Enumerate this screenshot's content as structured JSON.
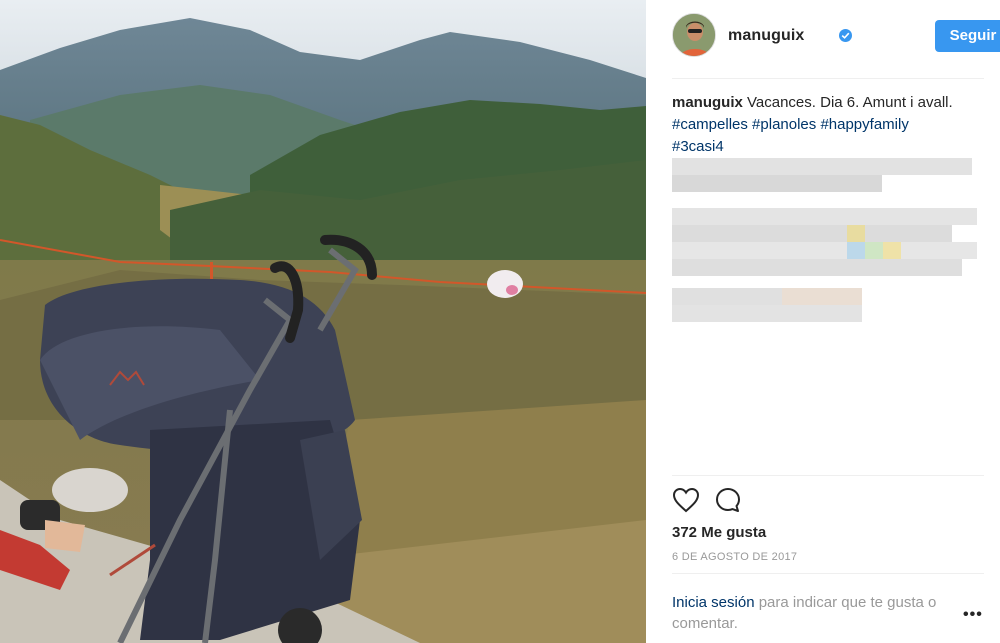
{
  "post": {
    "username": "manuguix",
    "follow_label": "Seguir",
    "caption_user": "manuguix",
    "caption_text": "Vacances. Dia 6. Amunt i avall.",
    "hashtags": [
      "#campelles",
      "#planoles",
      "#happyfamily",
      "#3casi4"
    ],
    "likes": "372 Me gusta",
    "date": "6 DE AGOSTO DE 2017",
    "login_link": "Inicia sesión",
    "login_rest": "para indicar que te gusta o comentar.",
    "more": "•••"
  },
  "colors": {
    "accent": "#3897f0",
    "link": "#003569",
    "muted": "#999999"
  },
  "icons": [
    "verified-badge-icon",
    "heart-icon",
    "comment-icon",
    "more-options-icon"
  ]
}
